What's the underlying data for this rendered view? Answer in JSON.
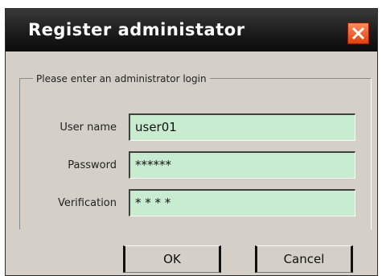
{
  "dialog": {
    "title": "Register administator",
    "legend": "Please enter an administrator login",
    "fields": [
      {
        "label": "User name",
        "value": "user01"
      },
      {
        "label": "Password",
        "value": "******"
      },
      {
        "label": "Verification",
        "value": "* * * *"
      }
    ],
    "ok_label": "OK",
    "cancel_label": "Cancel",
    "close_icon": "close-icon",
    "close_color": "#e04010"
  }
}
